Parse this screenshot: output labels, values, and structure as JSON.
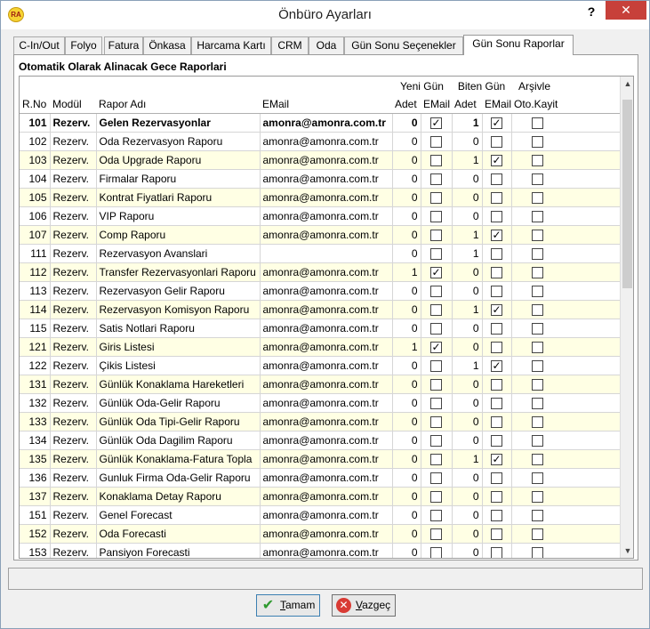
{
  "window": {
    "title": "Önbüro Ayarları",
    "help": "?",
    "close": "✕",
    "app_badge": "RA"
  },
  "tabs": [
    {
      "label": "C-In/Out"
    },
    {
      "label": "Folyo"
    },
    {
      "label": "Fatura"
    },
    {
      "label": "Önkasa"
    },
    {
      "label": "Harcama Kartı"
    },
    {
      "label": "CRM"
    },
    {
      "label": "Oda"
    },
    {
      "label": "Gün Sonu Seçenekler"
    },
    {
      "label": "Gün Sonu Raporlar"
    }
  ],
  "active_tab": 8,
  "section_title": "Otomatik Olarak Alinacak Gece Raporlari",
  "groups": {
    "yeni_gun": "Yeni Gün",
    "biten_gun": "Biten Gün",
    "arsivle": "Arşivle"
  },
  "columns": {
    "rno": "R.No",
    "modul": "Modül",
    "rapor_adi": "Rapor Adı",
    "email": "EMail",
    "adet1": "Adet",
    "email1": "EMail",
    "adet2": "Adet",
    "email2": "EMail",
    "oto": "Oto.Kayit"
  },
  "rows": [
    {
      "rno": "101",
      "modul": "Rezerv.",
      "name": "Gelen Rezervasyonlar",
      "email": "amonra@amonra.com.tr",
      "adet1": "0",
      "e1": true,
      "adet2": "1",
      "e2": true,
      "oto": false,
      "alt": false,
      "sel": true
    },
    {
      "rno": "102",
      "modul": "Rezerv.",
      "name": "Oda Rezervasyon Raporu",
      "email": "amonra@amonra.com.tr",
      "adet1": "0",
      "e1": false,
      "adet2": "0",
      "e2": false,
      "oto": false,
      "alt": false
    },
    {
      "rno": "103",
      "modul": "Rezerv.",
      "name": "Oda Upgrade Raporu",
      "email": "amonra@amonra.com.tr",
      "adet1": "0",
      "e1": false,
      "adet2": "1",
      "e2": true,
      "oto": false,
      "alt": true
    },
    {
      "rno": "104",
      "modul": "Rezerv.",
      "name": "Firmalar Raporu",
      "email": "amonra@amonra.com.tr",
      "adet1": "0",
      "e1": false,
      "adet2": "0",
      "e2": false,
      "oto": false,
      "alt": false
    },
    {
      "rno": "105",
      "modul": "Rezerv.",
      "name": "Kontrat Fiyatlari Raporu",
      "email": "amonra@amonra.com.tr",
      "adet1": "0",
      "e1": false,
      "adet2": "0",
      "e2": false,
      "oto": false,
      "alt": true
    },
    {
      "rno": "106",
      "modul": "Rezerv.",
      "name": "VIP Raporu",
      "email": "amonra@amonra.com.tr",
      "adet1": "0",
      "e1": false,
      "adet2": "0",
      "e2": false,
      "oto": false,
      "alt": false
    },
    {
      "rno": "107",
      "modul": "Rezerv.",
      "name": "Comp Raporu",
      "email": "amonra@amonra.com.tr",
      "adet1": "0",
      "e1": false,
      "adet2": "1",
      "e2": true,
      "oto": false,
      "alt": true
    },
    {
      "rno": "111",
      "modul": "Rezerv.",
      "name": "Rezervasyon Avanslari",
      "email": "",
      "adet1": "0",
      "e1": false,
      "adet2": "1",
      "e2": false,
      "oto": false,
      "alt": false
    },
    {
      "rno": "112",
      "modul": "Rezerv.",
      "name": "Transfer Rezervasyonlari Raporu",
      "email": "amonra@amonra.com.tr",
      "adet1": "1",
      "e1": true,
      "adet2": "0",
      "e2": false,
      "oto": false,
      "alt": true
    },
    {
      "rno": "113",
      "modul": "Rezerv.",
      "name": "Rezervasyon Gelir Raporu",
      "email": "amonra@amonra.com.tr",
      "adet1": "0",
      "e1": false,
      "adet2": "0",
      "e2": false,
      "oto": false,
      "alt": false
    },
    {
      "rno": "114",
      "modul": "Rezerv.",
      "name": "Rezervasyon Komisyon Raporu",
      "email": "amonra@amonra.com.tr",
      "adet1": "0",
      "e1": false,
      "adet2": "1",
      "e2": true,
      "oto": false,
      "alt": true
    },
    {
      "rno": "115",
      "modul": "Rezerv.",
      "name": "Satis Notlari Raporu",
      "email": "amonra@amonra.com.tr",
      "adet1": "0",
      "e1": false,
      "adet2": "0",
      "e2": false,
      "oto": false,
      "alt": false
    },
    {
      "rno": "121",
      "modul": "Rezerv.",
      "name": "Giris Listesi",
      "email": "amonra@amonra.com.tr",
      "adet1": "1",
      "e1": true,
      "adet2": "0",
      "e2": false,
      "oto": false,
      "alt": true
    },
    {
      "rno": "122",
      "modul": "Rezerv.",
      "name": "Çikis Listesi",
      "email": "amonra@amonra.com.tr",
      "adet1": "0",
      "e1": false,
      "adet2": "1",
      "e2": true,
      "oto": false,
      "alt": false
    },
    {
      "rno": "131",
      "modul": "Rezerv.",
      "name": "Günlük Konaklama Hareketleri",
      "email": "amonra@amonra.com.tr",
      "adet1": "0",
      "e1": false,
      "adet2": "0",
      "e2": false,
      "oto": false,
      "alt": true
    },
    {
      "rno": "132",
      "modul": "Rezerv.",
      "name": "Günlük Oda-Gelir Raporu",
      "email": "amonra@amonra.com.tr",
      "adet1": "0",
      "e1": false,
      "adet2": "0",
      "e2": false,
      "oto": false,
      "alt": false
    },
    {
      "rno": "133",
      "modul": "Rezerv.",
      "name": "Günlük Oda Tipi-Gelir Raporu",
      "email": "amonra@amonra.com.tr",
      "adet1": "0",
      "e1": false,
      "adet2": "0",
      "e2": false,
      "oto": false,
      "alt": true
    },
    {
      "rno": "134",
      "modul": "Rezerv.",
      "name": "Günlük Oda Dagilim Raporu",
      "email": "amonra@amonra.com.tr",
      "adet1": "0",
      "e1": false,
      "adet2": "0",
      "e2": false,
      "oto": false,
      "alt": false
    },
    {
      "rno": "135",
      "modul": "Rezerv.",
      "name": "Günlük Konaklama-Fatura Topla",
      "email": "amonra@amonra.com.tr",
      "adet1": "0",
      "e1": false,
      "adet2": "1",
      "e2": true,
      "oto": false,
      "alt": true
    },
    {
      "rno": "136",
      "modul": "Rezerv.",
      "name": "Gunluk Firma Oda-Gelir Raporu",
      "email": "amonra@amonra.com.tr",
      "adet1": "0",
      "e1": false,
      "adet2": "0",
      "e2": false,
      "oto": false,
      "alt": false
    },
    {
      "rno": "137",
      "modul": "Rezerv.",
      "name": "Konaklama Detay Raporu",
      "email": "amonra@amonra.com.tr",
      "adet1": "0",
      "e1": false,
      "adet2": "0",
      "e2": false,
      "oto": false,
      "alt": true
    },
    {
      "rno": "151",
      "modul": "Rezerv.",
      "name": "Genel Forecast",
      "email": "amonra@amonra.com.tr",
      "adet1": "0",
      "e1": false,
      "adet2": "0",
      "e2": false,
      "oto": false,
      "alt": false
    },
    {
      "rno": "152",
      "modul": "Rezerv.",
      "name": "Oda Forecasti",
      "email": "amonra@amonra.com.tr",
      "adet1": "0",
      "e1": false,
      "adet2": "0",
      "e2": false,
      "oto": false,
      "alt": true
    },
    {
      "rno": "153",
      "modul": "Rezerv.",
      "name": "Pansiyon Forecasti",
      "email": "amonra@amonra.com.tr",
      "adet1": "0",
      "e1": false,
      "adet2": "0",
      "e2": false,
      "oto": false,
      "alt": false
    }
  ],
  "buttons": {
    "ok_label": "Tamam",
    "ok_icon": "check-icon",
    "cancel_label": "Vazgeç",
    "cancel_icon": "x-circle-icon"
  },
  "colors": {
    "alt_row": "#ffffe4",
    "close_button": "#c7403a"
  }
}
